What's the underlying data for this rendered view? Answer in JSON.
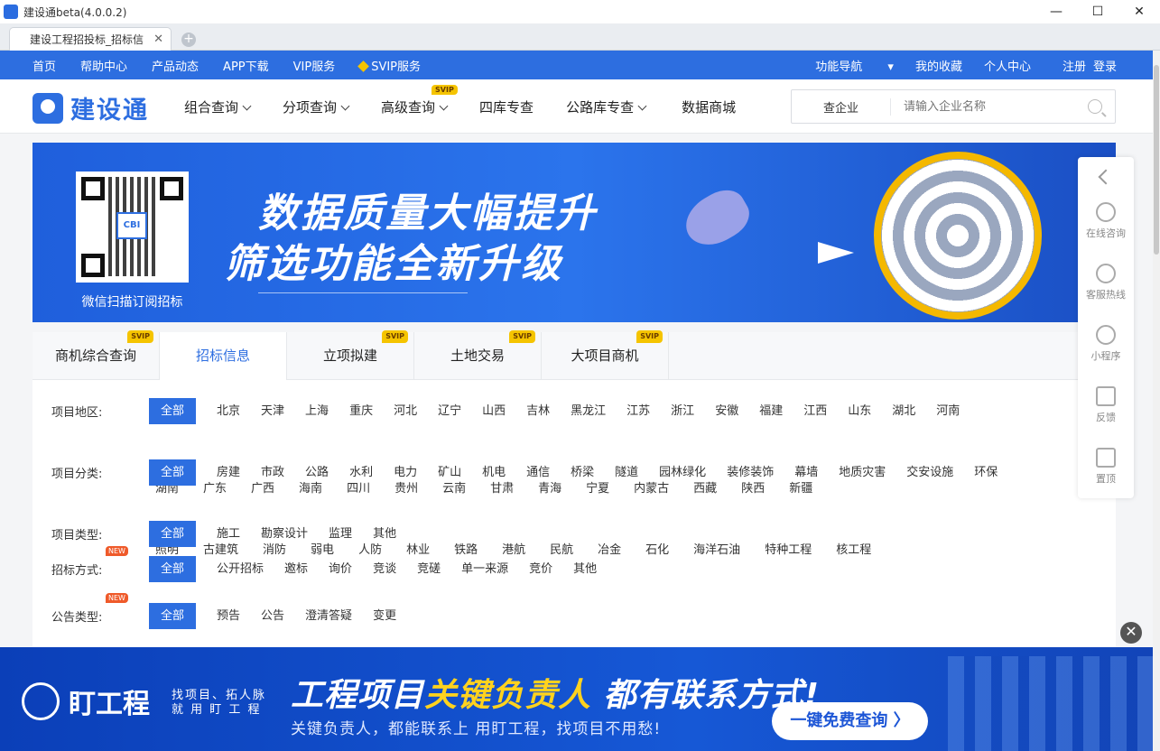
{
  "window": {
    "title": "建设通beta(4.0.0.2)",
    "minimize": "—",
    "maximize": "☐",
    "close": "✕"
  },
  "browser": {
    "tab_label": "建设工程招投标_招标信",
    "tab_close": "✕",
    "add_tab": "+"
  },
  "topnav": {
    "left": [
      "首页",
      "帮助中心",
      "产品动态",
      "APP下载",
      "VIP服务",
      "SVIP服务"
    ],
    "right": [
      "功能导航",
      "我的收藏",
      "个人中心",
      "注册",
      "登录"
    ]
  },
  "header": {
    "logo_text": "建设通",
    "menu": [
      "组合查询",
      "分项查询",
      "高级查询",
      "四库专查",
      "公路库专查",
      "数据商城"
    ],
    "svip_badge": "SVIP",
    "search_scope": "查企业",
    "search_placeholder": "请输入企业名称"
  },
  "banner": {
    "qr_logo": "CBI",
    "qr_caption": "微信扫描订阅招标",
    "headline1": "数据质量大幅提升",
    "headline2": "筛选功能全新升级"
  },
  "sections": {
    "tabs": [
      "商机综合查询",
      "招标信息",
      "立项拟建",
      "土地交易",
      "大项目商机"
    ],
    "active_index": 1,
    "svip_badge": "SVIP",
    "new_badge": "NEW"
  },
  "filters": {
    "region": {
      "label": "项目地区:",
      "all": "全部",
      "row1": [
        "北京",
        "天津",
        "上海",
        "重庆",
        "河北",
        "辽宁",
        "山西",
        "吉林",
        "黑龙江",
        "江苏",
        "浙江",
        "安徽",
        "福建",
        "江西",
        "山东",
        "湖北",
        "河南"
      ],
      "row2": [
        "湖南",
        "广东",
        "广西",
        "海南",
        "四川",
        "贵州",
        "云南",
        "甘肃",
        "青海",
        "宁夏",
        "内蒙古",
        "西藏",
        "陕西",
        "新疆"
      ]
    },
    "category": {
      "label": "项目分类:",
      "all": "全部",
      "row1": [
        "房建",
        "市政",
        "公路",
        "水利",
        "电力",
        "矿山",
        "机电",
        "通信",
        "桥梁",
        "隧道",
        "园林绿化",
        "装修装饰",
        "幕墙",
        "地质灾害",
        "交安设施",
        "环保"
      ],
      "row2": [
        "照明",
        "古建筑",
        "消防",
        "弱电",
        "人防",
        "林业",
        "铁路",
        "港航",
        "民航",
        "冶金",
        "石化",
        "海洋石油",
        "特种工程",
        "核工程"
      ]
    },
    "type": {
      "label": "项目类型:",
      "all": "全部",
      "options": [
        "施工",
        "勘察设计",
        "监理",
        "其他"
      ]
    },
    "method": {
      "label": "招标方式:",
      "all": "全部",
      "options": [
        "公开招标",
        "邀标",
        "询价",
        "竞谈",
        "竞磋",
        "单一来源",
        "竞价",
        "其他"
      ]
    },
    "notice": {
      "label": "公告类型:",
      "all": "全部",
      "options": [
        "预告",
        "公告",
        "澄清答疑",
        "变更"
      ]
    }
  },
  "sidebar": [
    "在线咨询",
    "客服热线",
    "小程序",
    "反馈",
    "置顶"
  ],
  "ad": {
    "close": "✕",
    "brand": "盯工程",
    "slogan": "找项目、拓人脉 就 用 盯 工 程",
    "headline_a": "工程项目",
    "headline_b": "关键负责人",
    "headline_c": " 都有联系方式!",
    "sub": "关键负责人，都能联系上  用盯工程，找项目不用愁!",
    "cta": "一键免费查询 〉"
  },
  "colors": {
    "primary": "#2d6ee0",
    "svip": "#f5c400",
    "new": "#ef5a2a"
  }
}
